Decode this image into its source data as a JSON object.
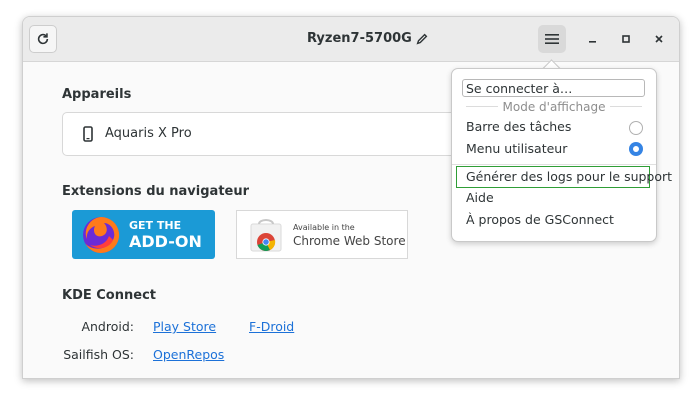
{
  "window": {
    "title": "Ryzen7-5700G"
  },
  "header": {
    "refresh_icon": "refresh-icon",
    "edit_icon": "pencil-icon",
    "menu_icon": "hamburger-menu-icon",
    "minimize_icon": "minimize-icon",
    "maximize_icon": "maximize-icon",
    "close_icon": "close-icon"
  },
  "devices": {
    "title": "Appareils",
    "items": [
      {
        "label": "Aquaris X Pro",
        "icon": "smartphone-icon"
      }
    ]
  },
  "extensions": {
    "title": "Extensions du navigateur",
    "firefox": {
      "line1": "GET THE",
      "line2": "ADD-ON"
    },
    "chrome": {
      "line1": "Available in the",
      "line2": "Chrome Web Store"
    }
  },
  "kde": {
    "title": "KDE Connect",
    "rows": [
      {
        "label": "Android:",
        "links": [
          "Play Store",
          "F-Droid"
        ]
      },
      {
        "label": "Sailfish OS:",
        "links": [
          "OpenRepos"
        ]
      }
    ]
  },
  "menu": {
    "connect": "Se connecter à…",
    "section_label": "Mode d'affichage",
    "options": [
      {
        "label": "Barre des tâches",
        "selected": false
      },
      {
        "label": "Menu utilisateur",
        "selected": true
      }
    ],
    "generate_logs": "Générer des logs pour le support",
    "help": "Aide",
    "about": "À propos de GSConnect"
  },
  "colors": {
    "accent": "#3584e4",
    "link": "#1c71d8",
    "highlight": "#2f9e36",
    "firefox_badge": "#1b9ad6"
  }
}
